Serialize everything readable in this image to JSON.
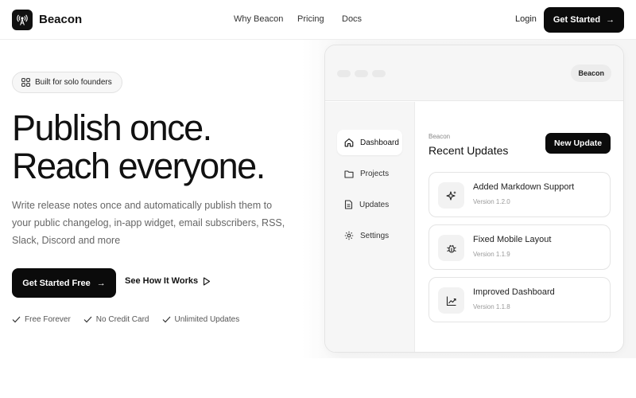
{
  "header": {
    "brand": "Beacon",
    "nav": [
      "Why Beacon",
      "Pricing",
      "Docs"
    ],
    "login": "Login",
    "cta": "Get Started",
    "cta_arrow": "→"
  },
  "hero": {
    "badge": "Built for solo founders",
    "headline_line1": "Publish once.",
    "headline_line2": "Reach everyone.",
    "subtext": "Write release notes once and automatically publish them to your public changelog, in-app widget, email subscribers, RSS, Slack, Discord and more",
    "primary_cta": "Get Started Free",
    "primary_arrow": "→",
    "secondary_cta": "See How It Works",
    "features": [
      "Free Forever",
      "No Credit Card",
      "Unlimited Updates"
    ]
  },
  "mockup": {
    "pill": "Beacon",
    "sidebar": [
      {
        "label": "Dashboard",
        "icon": "home-icon",
        "active": true
      },
      {
        "label": "Projects",
        "icon": "folder-icon",
        "active": false
      },
      {
        "label": "Updates",
        "icon": "document-icon",
        "active": false
      },
      {
        "label": "Settings",
        "icon": "gear-icon",
        "active": false
      }
    ],
    "small_label": "Beacon",
    "title": "Recent Updates",
    "new_button": "New Update",
    "updates": [
      {
        "title": "Added Markdown Support",
        "version": "Version 1.2.0",
        "icon": "sparkle-icon"
      },
      {
        "title": "Fixed Mobile Layout",
        "version": "Version 1.1.9",
        "icon": "bug-icon"
      },
      {
        "title": "Improved Dashboard",
        "version": "Version 1.1.8",
        "icon": "chart-icon"
      }
    ]
  },
  "colors": {
    "primary": "#0b0b0b",
    "panel": "#f6f6f6",
    "text_muted": "#666666"
  }
}
